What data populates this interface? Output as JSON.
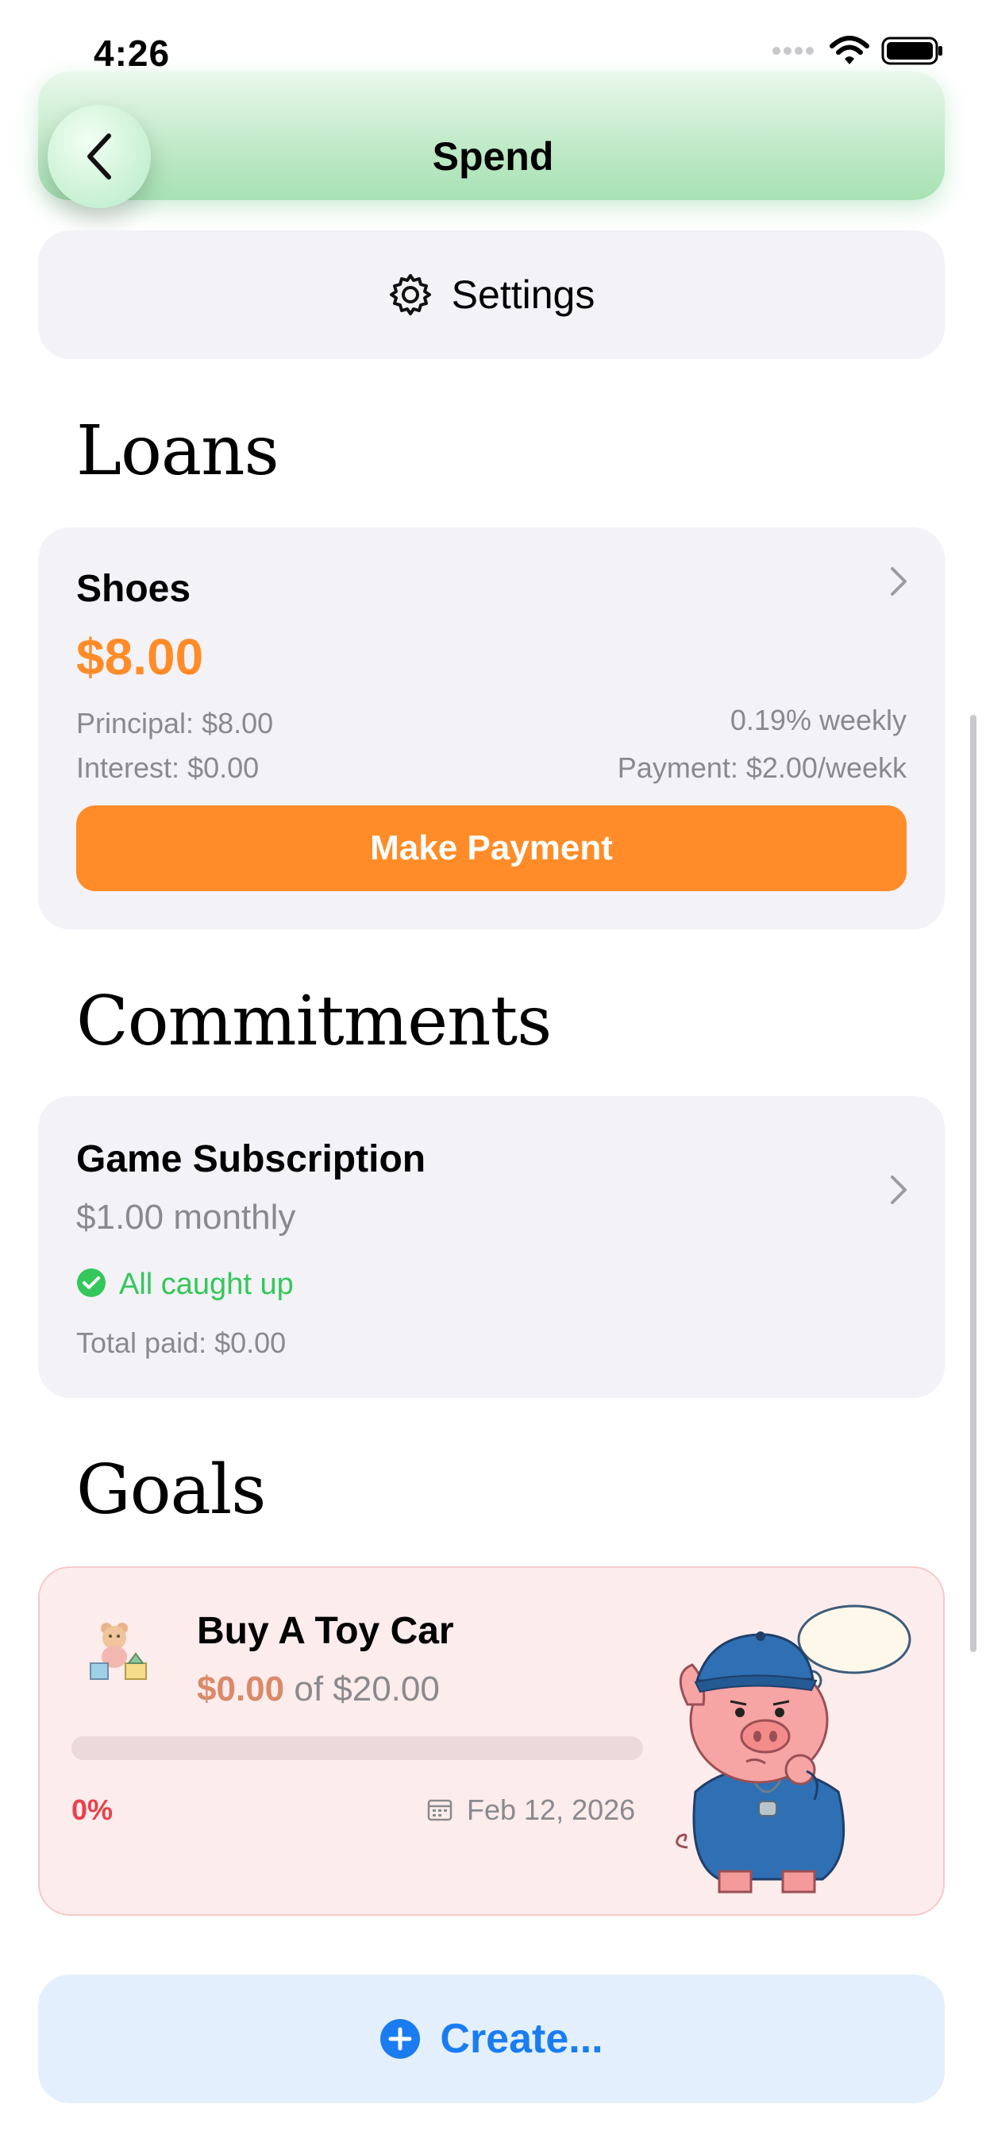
{
  "status_bar": {
    "time": "4:26"
  },
  "nav": {
    "title": "Spend"
  },
  "settings": {
    "label": "Settings"
  },
  "loans": {
    "title": "Loans",
    "items": [
      {
        "name": "Shoes",
        "amount": "$8.00",
        "principal": "Principal: $8.00",
        "interest": "Interest: $0.00",
        "rate": "0.19% weekly",
        "payment": "Payment: $2.00/weekk",
        "action": "Make Payment"
      }
    ]
  },
  "commitments": {
    "title": "Commitments",
    "items": [
      {
        "name": "Game Subscription",
        "amount": "$1.00 monthly",
        "status": "All caught up",
        "total_paid": "Total paid: $0.00"
      }
    ]
  },
  "goals": {
    "title": "Goals",
    "items": [
      {
        "name": "Buy A Toy Car",
        "saved": "$0.00",
        "target_text": "of $20.00",
        "progress_fraction": 0,
        "percent": "0%",
        "date": "Feb 12, 2026"
      }
    ]
  },
  "create": {
    "label": "Create..."
  },
  "colors": {
    "accent_orange": "#ff8c28",
    "success_green": "#34c759",
    "link_blue": "#1a7cf0",
    "percent_red": "#e8414c",
    "goal_amount": "#d98a6a"
  }
}
